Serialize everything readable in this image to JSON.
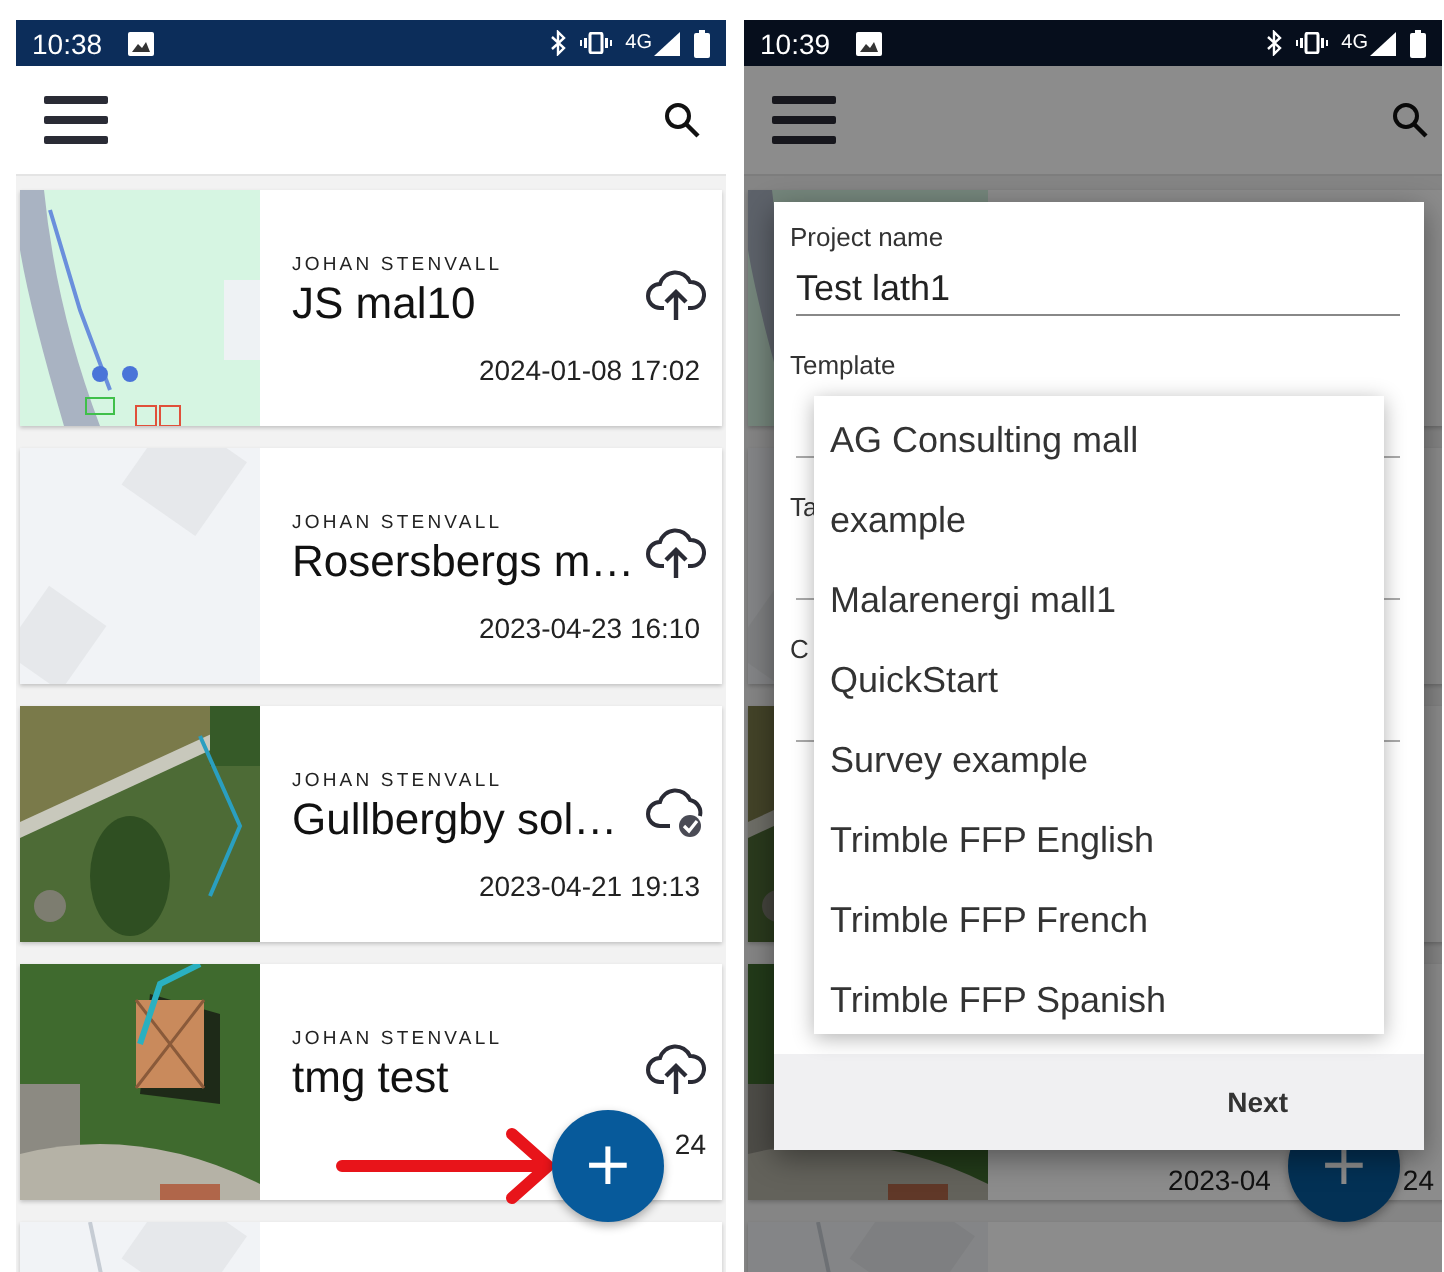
{
  "left_screen": {
    "status_bar": {
      "time": "10:38",
      "network": "4G"
    },
    "projects": [
      {
        "owner": "JOHAN STENVALL",
        "name": "JS mal10",
        "date_parts": [
          "2024-01-08 17:02"
        ],
        "kind": "upload"
      },
      {
        "owner": "JOHAN STENVALL",
        "name": "Rosersbergs m…",
        "date_parts": [
          "2023-04-23 16:10"
        ],
        "kind": "upload"
      },
      {
        "owner": "JOHAN STENVALL",
        "name": "Gullbergby sol…",
        "date_parts": [
          "2023-04-21 19:13"
        ],
        "kind": "synced"
      },
      {
        "owner": "JOHAN STENVALL",
        "name": "tmg test",
        "date_parts": [
          "24"
        ],
        "kind": "upload"
      }
    ],
    "fab": {
      "label": "+"
    }
  },
  "right_screen": {
    "status_bar": {
      "time": "10:39",
      "network": "4G"
    },
    "dialog": {
      "fields": [
        {
          "label": "Project name",
          "value": "Test lath1"
        },
        {
          "label": "Template"
        },
        {
          "label": "Ta"
        },
        {
          "label": "C"
        }
      ],
      "dropdown": {
        "options": [
          "AG Consulting mall",
          "example",
          "Malarenergi mall1",
          "QuickStart",
          "Survey example",
          "Trimble FFP English",
          "Trimble FFP French",
          "Trimble FFP Spanish"
        ]
      },
      "next_button": "Next"
    },
    "background_date_parts": [
      "2023-04",
      "24"
    ],
    "fab": {
      "label": "+"
    }
  }
}
